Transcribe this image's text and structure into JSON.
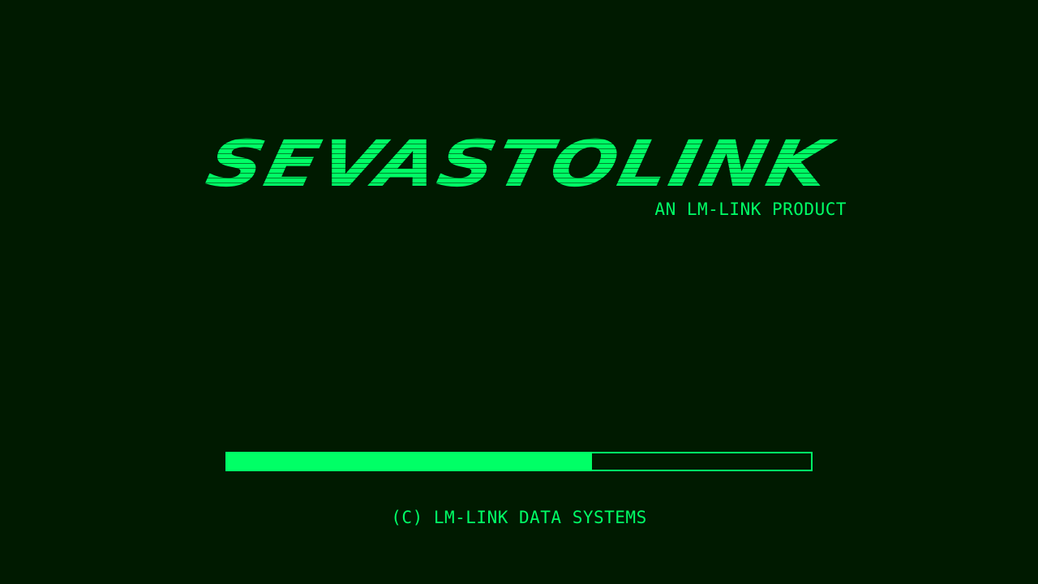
{
  "splash": {
    "title": "SEVASTOLINK",
    "subtitle": "AN LM-LINK PRODUCT",
    "copyright": "(C) LM-LINK DATA SYSTEMS"
  },
  "loading": {
    "progress_fraction": 0.625
  },
  "colors": {
    "background": "#001a00",
    "accent": "#00ff66"
  }
}
